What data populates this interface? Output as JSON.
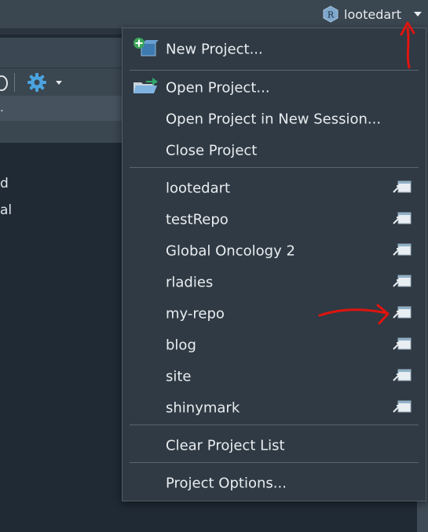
{
  "topbar": {
    "project_label": "lootedart",
    "r_letter": "R"
  },
  "left_pane": {
    "path_fragment": ".",
    "line1_fragment": "d",
    "line2_fragment": "al"
  },
  "menu": {
    "new_project": "New Project...",
    "open_project": "Open Project...",
    "open_in_new_session": "Open Project in New Session...",
    "close_project": "Close Project",
    "recent_projects": [
      {
        "name": "lootedart"
      },
      {
        "name": "testRepo"
      },
      {
        "name": "Global Oncology 2"
      },
      {
        "name": "rladies"
      },
      {
        "name": "my-repo"
      },
      {
        "name": "blog"
      },
      {
        "name": "site"
      },
      {
        "name": "shinymark"
      }
    ],
    "clear_list": "Clear Project List",
    "project_options": "Project Options..."
  },
  "colors": {
    "menu_bg": "#2f3a44",
    "topbar_bg": "#3a4650",
    "annotation_red": "#e0140f",
    "gear_blue": "#4aa3df"
  },
  "icons": {
    "topbar_project": "r-project-icon",
    "new_project": "new-project-icon",
    "open_project": "open-folder-icon",
    "recent_open": "open-in-new-window-icon",
    "toolbar_gear": "gear-icon"
  }
}
